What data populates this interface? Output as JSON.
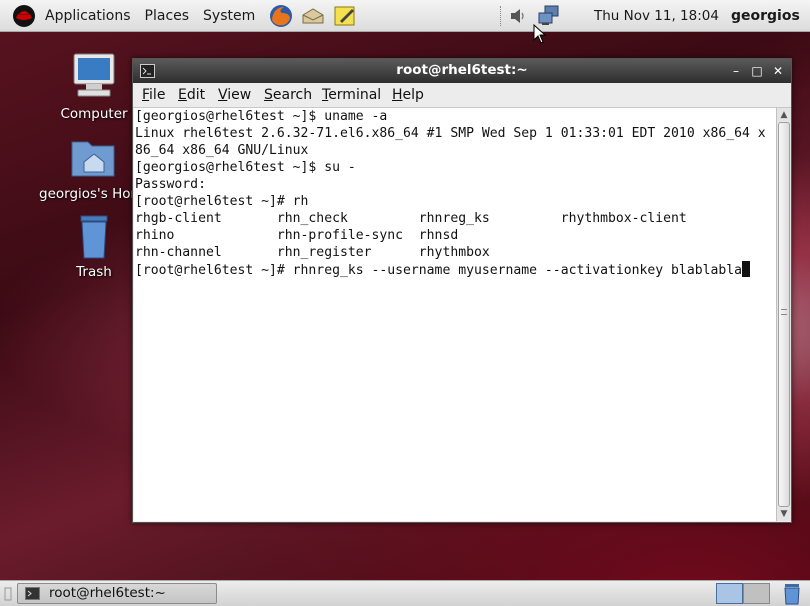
{
  "top_panel": {
    "menus": [
      "Applications",
      "Places",
      "System"
    ],
    "launchers": [
      "firefox-icon",
      "mail-icon",
      "notes-icon"
    ],
    "clock": "Thu Nov 11, 18:04",
    "user": "georgios"
  },
  "desktop": {
    "icons": [
      {
        "label": "Computer",
        "icon": "computer-icon"
      },
      {
        "label": "georgios's Home",
        "icon": "home-folder-icon"
      },
      {
        "label": "Trash",
        "icon": "trash-icon"
      }
    ]
  },
  "terminal": {
    "title": "root@rhel6test:~",
    "menu": {
      "file": {
        "u": "F",
        "rest": "ile"
      },
      "edit": {
        "u": "E",
        "rest": "dit"
      },
      "view": {
        "u": "V",
        "rest": "iew"
      },
      "search": {
        "u": "S",
        "rest": "earch"
      },
      "terminal": {
        "u": "T",
        "rest": "erminal"
      },
      "help": {
        "u": "H",
        "rest": "elp"
      }
    },
    "lines": [
      "[georgios@rhel6test ~]$ uname -a",
      "Linux rhel6test 2.6.32-71.el6.x86_64 #1 SMP Wed Sep 1 01:33:01 EDT 2010 x86_64 x",
      "86_64 x86_64 GNU/Linux",
      "[georgios@rhel6test ~]$ su -",
      "Password:",
      "[root@rhel6test ~]# rh",
      "rhgb-client       rhn_check         rhnreg_ks         rhythmbox-client",
      "rhino             rhn-profile-sync  rhnsd",
      "rhn-channel       rhn_register      rhythmbox",
      "[root@rhel6test ~]# rhnreg_ks --username myusername --activationkey blablabla"
    ]
  },
  "bottom_panel": {
    "task": "root@rhel6test:~"
  },
  "colors": {
    "panel": "#e4e4e4",
    "titlebar": "#3c3c3c",
    "workspace_active": "#a9c4e4"
  }
}
